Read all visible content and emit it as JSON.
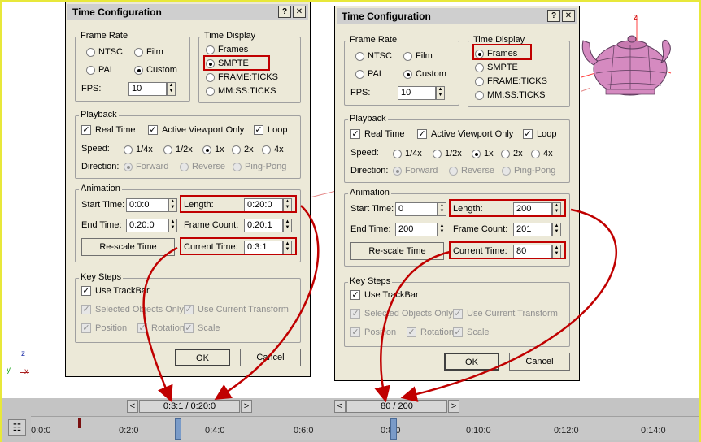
{
  "left_dialog": {
    "title": "Time Configuration",
    "help_label": "?",
    "close_label": "✕",
    "frame_rate": {
      "label": "Frame Rate",
      "ntsc": "NTSC",
      "film": "Film",
      "pal": "PAL",
      "custom": "Custom",
      "fps_label": "FPS:",
      "fps_value": "10",
      "selected": "Custom"
    },
    "time_display": {
      "label": "Time Display",
      "frames": "Frames",
      "smpte": "SMPTE",
      "frame_ticks": "FRAME:TICKS",
      "mmss_ticks": "MM:SS:TICKS",
      "selected": "SMPTE"
    },
    "playback": {
      "label": "Playback",
      "real_time": "Real Time",
      "active_viewport": "Active Viewport Only",
      "loop": "Loop",
      "speed_label": "Speed:",
      "s1": "1/4x",
      "s2": "1/2x",
      "s3": "1x",
      "s4": "2x",
      "s5": "4x",
      "direction_label": "Direction:",
      "forward": "Forward",
      "reverse": "Reverse",
      "pingpong": "Ping-Pong"
    },
    "animation": {
      "label": "Animation",
      "start_label": "Start Time:",
      "start_value": "0:0:0",
      "end_label": "End Time:",
      "end_value": "0:20:0",
      "length_label": "Length:",
      "length_value": "0:20:0",
      "frame_count_label": "Frame Count:",
      "frame_count_value": "0:20:1",
      "rescale_label": "Re-scale Time",
      "current_label": "Current Time:",
      "current_value": "0:3:1"
    },
    "key_steps": {
      "label": "Key Steps",
      "use_trackbar": "Use TrackBar",
      "selected_only": "Selected Objects Only",
      "use_current": "Use Current Transform",
      "position": "Position",
      "rotation": "Rotation",
      "scale": "Scale"
    },
    "ok_label": "OK",
    "cancel_label": "Cancel"
  },
  "right_dialog": {
    "title": "Time Configuration",
    "help_label": "?",
    "close_label": "✕",
    "frame_rate": {
      "label": "Frame Rate",
      "ntsc": "NTSC",
      "film": "Film",
      "pal": "PAL",
      "custom": "Custom",
      "fps_label": "FPS:",
      "fps_value": "10",
      "selected": "Custom"
    },
    "time_display": {
      "label": "Time Display",
      "frames": "Frames",
      "smpte": "SMPTE",
      "frame_ticks": "FRAME:TICKS",
      "mmss_ticks": "MM:SS:TICKS",
      "selected": "Frames"
    },
    "playback": {
      "label": "Playback",
      "real_time": "Real Time",
      "active_viewport": "Active Viewport Only",
      "loop": "Loop",
      "speed_label": "Speed:",
      "s1": "1/4x",
      "s2": "1/2x",
      "s3": "1x",
      "s4": "2x",
      "s5": "4x",
      "direction_label": "Direction:",
      "forward": "Forward",
      "reverse": "Reverse",
      "pingpong": "Ping-Pong"
    },
    "animation": {
      "label": "Animation",
      "start_label": "Start Time:",
      "start_value": "0",
      "end_label": "End Time:",
      "end_value": "200",
      "length_label": "Length:",
      "length_value": "200",
      "frame_count_label": "Frame Count:",
      "frame_count_value": "201",
      "rescale_label": "Re-scale Time",
      "current_label": "Current Time:",
      "current_value": "80"
    },
    "key_steps": {
      "label": "Key Steps",
      "use_trackbar": "Use TrackBar",
      "selected_only": "Selected Objects Only",
      "use_current": "Use Current Transform",
      "position": "Position",
      "rotation": "Rotation",
      "scale": "Scale"
    },
    "ok_label": "OK",
    "cancel_label": "Cancel"
  },
  "timeline": {
    "left_slider": "0:3:1 / 0:20:0",
    "right_slider": "80 / 200",
    "prev": "<",
    "next": ">",
    "ticks": [
      "0:0:0",
      "0:2:0",
      "0:4:0",
      "0:6:0",
      "0:8:0",
      "0:10:0",
      "0:12:0",
      "0:14:0"
    ]
  },
  "viewport": {
    "axis_z": "z",
    "axis_x": "x",
    "axis_y": "y"
  },
  "colors": {
    "highlight": "#c00000",
    "dialog_bg": "#ece9d8",
    "teapot": "#d58ac0"
  }
}
